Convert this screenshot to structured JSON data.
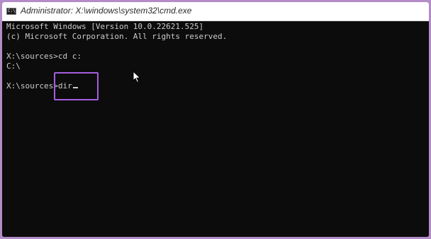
{
  "window": {
    "title": "Administrator: X:\\windows\\system32\\cmd.exe",
    "icon": "cmd-icon",
    "icon_glyph": "C:\\"
  },
  "console": {
    "lines": [
      "Microsoft Windows [Version 10.0.22621.525]",
      "(c) Microsoft Corporation. All rights reserved.",
      "X:\\sources>cd c:",
      "C:\\",
      "X:\\sources>dir"
    ],
    "text_color": "#cccccc",
    "background": "#0c0c0c"
  },
  "annotation": {
    "highlight_color": "#a45ee0"
  }
}
